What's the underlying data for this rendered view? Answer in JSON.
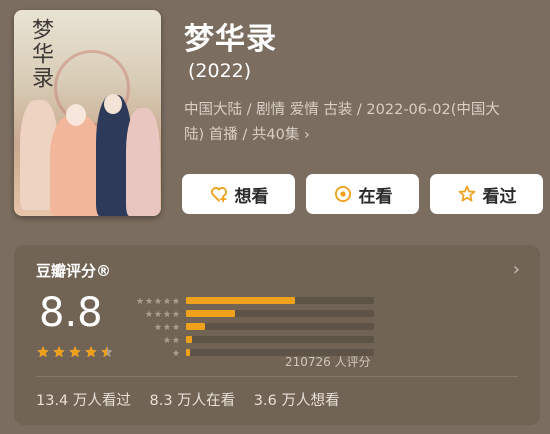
{
  "header": {
    "title": "梦华录",
    "year": "(2022)",
    "meta_line1": "中国大陆 / 剧情 爱情 古装 / 2022-06-02(中国大",
    "meta_line2": "陆) 首播 / 共40集",
    "meta_chevron": "›"
  },
  "poster": {
    "calligraphy": "梦华录"
  },
  "actions": [
    {
      "label": "想看",
      "icon": "heart-plus-icon"
    },
    {
      "label": "在看",
      "icon": "target-icon"
    },
    {
      "label": "看过",
      "icon": "star-outline-icon"
    }
  ],
  "rating": {
    "title": "豆瓣评分®",
    "chevron": "›",
    "score": "8.8",
    "stars": 4.5,
    "distribution": [
      0.58,
      0.26,
      0.1,
      0.03,
      0.02
    ],
    "count_text": "210726 人评分",
    "accent": "#f0a11b"
  },
  "stats": {
    "watched": "13.4 万人看过",
    "watching": "8.3 万人在看",
    "want": "3.6 万人想看"
  }
}
